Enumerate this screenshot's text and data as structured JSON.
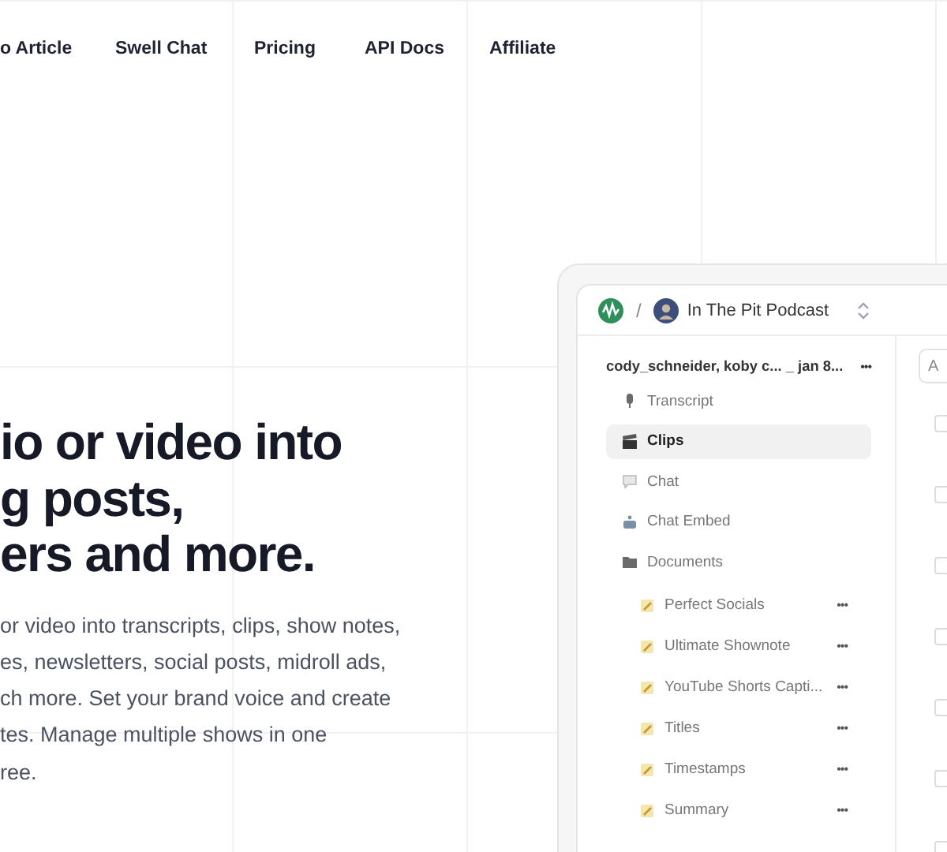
{
  "nav": {
    "links": [
      "o Article",
      "Swell Chat",
      "Pricing",
      "API Docs",
      "Affiliate"
    ]
  },
  "hero": {
    "heading_lines": [
      "io or video into",
      "g posts,",
      "ers and more."
    ],
    "paragraph_lines": [
      "or video into transcripts, clips, show notes,",
      "es, newsletters, social posts, midroll ads,",
      "ch more. Set your brand voice and create",
      "tes. Manage multiple shows in one",
      "ree."
    ]
  },
  "app": {
    "header": {
      "separator": "/",
      "podcast": "In The Pit Podcast"
    },
    "sidebar": {
      "episode": "cody_schneider, koby c... _ jan 8...",
      "more": "•••",
      "items": [
        {
          "label": "Transcript",
          "kind": "mic",
          "selected": false
        },
        {
          "label": "Clips",
          "kind": "clapper",
          "selected": true
        },
        {
          "label": "Chat",
          "kind": "bubble",
          "selected": false
        },
        {
          "label": "Chat Embed",
          "kind": "robot",
          "selected": false
        },
        {
          "label": "Documents",
          "kind": "folder",
          "selected": false,
          "children": [
            {
              "label": "Perfect Socials",
              "more": "•••"
            },
            {
              "label": "Ultimate Shownote",
              "more": "•••"
            },
            {
              "label": "YouTube Shorts Capti...",
              "more": "•••"
            },
            {
              "label": "Titles",
              "more": "•••"
            },
            {
              "label": "Timestamps",
              "more": "•••"
            },
            {
              "label": "Summary",
              "more": "•••"
            }
          ]
        }
      ]
    },
    "main": {
      "field_text": "A",
      "checkboxes": [
        {
          "checked": false
        },
        {
          "checked": false
        },
        {
          "checked": false
        },
        {
          "checked": false
        },
        {
          "checked": false
        },
        {
          "checked": false
        },
        {
          "checked": false
        }
      ]
    }
  }
}
